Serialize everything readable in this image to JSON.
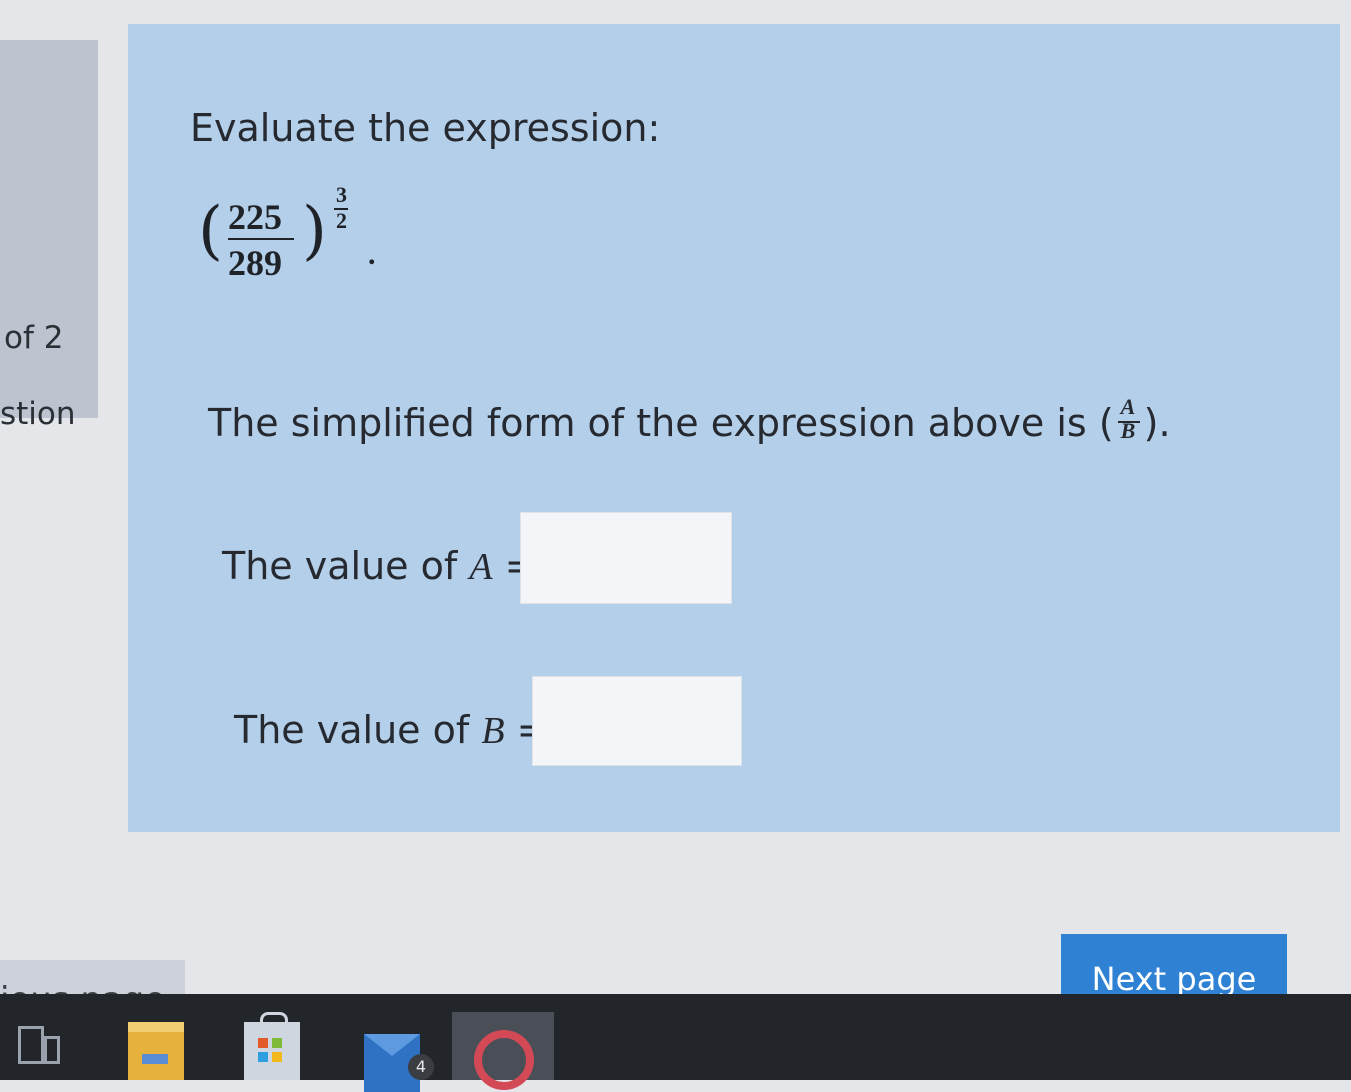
{
  "sidebar": {
    "page_of": "of 2",
    "question_label": "stion"
  },
  "question": {
    "heading": "Evaluate the expression:",
    "expression": {
      "numerator": "225",
      "denominator": "289",
      "exponent_numerator": "3",
      "exponent_denominator": "2",
      "trailing": "."
    },
    "simplified_prefix": "The simplified form of the expression above is",
    "simplified_open": "(",
    "simplified_a": "A",
    "simplified_b": "B",
    "simplified_close": ").",
    "value_a_prefix": "The value of",
    "value_a_var": "A",
    "value_a_eq": "=",
    "value_b_prefix": "The value of",
    "value_b_var": "B",
    "value_b_eq": "=",
    "value_a_input": "",
    "value_b_input": ""
  },
  "navigation": {
    "previous_label": "ious page",
    "next_label": "Next page"
  },
  "taskbar": {
    "mail_badge": "4",
    "icons": [
      "task-view-icon",
      "file-explorer-icon",
      "store-icon",
      "mail-icon",
      "opera-icon"
    ]
  }
}
